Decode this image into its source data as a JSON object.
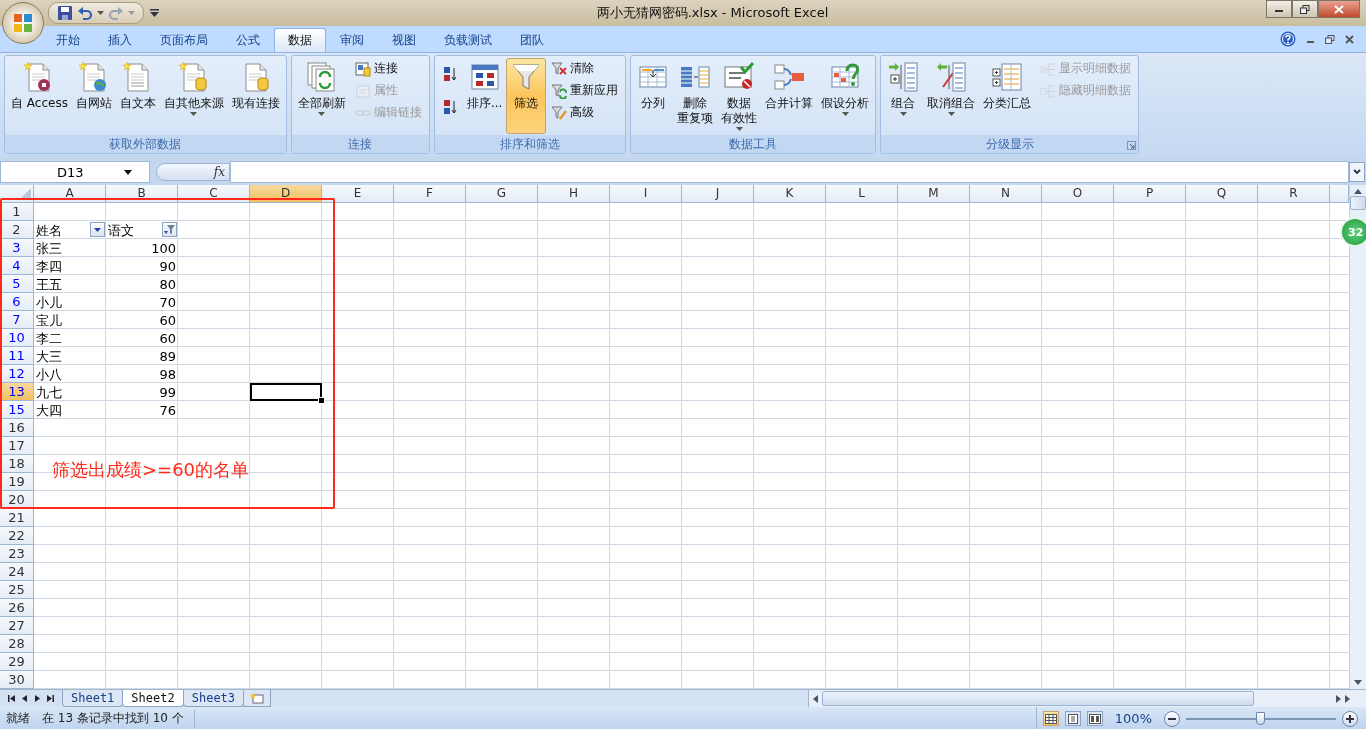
{
  "window": {
    "title": "两小无猜网密码.xlsx - Microsoft Excel"
  },
  "ribbon_tabs": [
    {
      "label": "开始",
      "selected": false
    },
    {
      "label": "插入",
      "selected": false
    },
    {
      "label": "页面布局",
      "selected": false
    },
    {
      "label": "公式",
      "selected": false
    },
    {
      "label": "数据",
      "selected": true
    },
    {
      "label": "审阅",
      "selected": false
    },
    {
      "label": "视图",
      "selected": false
    },
    {
      "label": "负载测试",
      "selected": false
    },
    {
      "label": "团队",
      "selected": false
    }
  ],
  "ribbon_groups": [
    {
      "title": "获取外部数据",
      "dialog_launcher": false,
      "items": [
        {
          "kind": "large",
          "label": "自 Access",
          "dropdown": false,
          "disabled": false,
          "selected": false
        },
        {
          "kind": "large",
          "label": "自网站",
          "dropdown": false,
          "disabled": false,
          "selected": false
        },
        {
          "kind": "large",
          "label": "自文本",
          "dropdown": false,
          "disabled": false,
          "selected": false
        },
        {
          "kind": "large",
          "label": "自其他来源",
          "dropdown": true,
          "disabled": false,
          "selected": false
        },
        {
          "kind": "large",
          "label": "现有连接",
          "dropdown": false,
          "disabled": false,
          "selected": false
        }
      ]
    },
    {
      "title": "连接",
      "dialog_launcher": false,
      "items": [
        {
          "kind": "large",
          "label": "全部刷新",
          "dropdown": true,
          "disabled": false,
          "selected": false
        },
        {
          "kind": "stack",
          "items": [
            {
              "label": "连接",
              "disabled": false
            },
            {
              "label": "属性",
              "disabled": true
            },
            {
              "label": "编辑链接",
              "disabled": true
            }
          ]
        }
      ]
    },
    {
      "title": "排序和筛选",
      "dialog_launcher": false,
      "items": [
        {
          "kind": "stack",
          "items": [
            {
              "disabled": false
            },
            {
              "disabled": false
            }
          ]
        },
        {
          "kind": "large",
          "label": "排序...",
          "dropdown": false,
          "disabled": false,
          "selected": false
        },
        {
          "kind": "large",
          "label": "筛选",
          "dropdown": false,
          "disabled": false,
          "selected": true
        },
        {
          "kind": "stack",
          "items": [
            {
              "label": "清除",
              "disabled": false
            },
            {
              "label": "重新应用",
              "disabled": false
            },
            {
              "label": "高级",
              "disabled": false
            }
          ]
        }
      ]
    },
    {
      "title": "数据工具",
      "dialog_launcher": false,
      "items": [
        {
          "kind": "large",
          "label": "分列",
          "dropdown": false,
          "disabled": false,
          "selected": false
        },
        {
          "kind": "large",
          "lines": [
            "删除",
            "重复项"
          ],
          "dropdown": false,
          "disabled": false,
          "selected": false
        },
        {
          "kind": "large",
          "lines": [
            "数据",
            "有效性"
          ],
          "dropdown": true,
          "disabled": false,
          "selected": false
        },
        {
          "kind": "large",
          "label": "合并计算",
          "dropdown": false,
          "disabled": false,
          "selected": false
        },
        {
          "kind": "large",
          "label": "假设分析",
          "dropdown": true,
          "disabled": false,
          "selected": false
        }
      ]
    },
    {
      "title": "分级显示",
      "dialog_launcher": true,
      "items": [
        {
          "kind": "large",
          "label": "组合",
          "dropdown": true,
          "disabled": false,
          "selected": false
        },
        {
          "kind": "large",
          "label": "取消组合",
          "dropdown": true,
          "disabled": false,
          "selected": false
        },
        {
          "kind": "large",
          "label": "分类汇总",
          "dropdown": false,
          "disabled": false,
          "selected": false
        },
        {
          "kind": "stack",
          "items": [
            {
              "label": "显示明细数据",
              "disabled": true
            },
            {
              "label": "隐藏明细数据",
              "disabled": true
            }
          ]
        }
      ]
    }
  ],
  "formula_bar": {
    "name_box": "D13",
    "function_button": "fx"
  },
  "columns": [
    {
      "label": "A",
      "selected": false
    },
    {
      "label": "B",
      "selected": false
    },
    {
      "label": "C",
      "selected": false
    },
    {
      "label": "D",
      "selected": true
    },
    {
      "label": "E",
      "selected": false
    },
    {
      "label": "F",
      "selected": false
    },
    {
      "label": "G",
      "selected": false
    },
    {
      "label": "H",
      "selected": false
    },
    {
      "label": "I",
      "selected": false
    },
    {
      "label": "J",
      "selected": false
    },
    {
      "label": "K",
      "selected": false
    },
    {
      "label": "L",
      "selected": false
    },
    {
      "label": "M",
      "selected": false
    },
    {
      "label": "N",
      "selected": false
    },
    {
      "label": "O",
      "selected": false
    },
    {
      "label": "P",
      "selected": false
    },
    {
      "label": "Q",
      "selected": false
    },
    {
      "label": "R",
      "selected": false
    }
  ],
  "rows": [
    {
      "number": "1",
      "filtered": false,
      "selected": false
    },
    {
      "number": "2",
      "filtered": false,
      "selected": false,
      "header": [
        {
          "label": "姓名",
          "filter_active": false
        },
        {
          "label": "语文",
          "filter_active": true
        }
      ]
    },
    {
      "number": "3",
      "filtered": true,
      "selected": false,
      "name": "张三",
      "score": "100"
    },
    {
      "number": "4",
      "filtered": true,
      "selected": false,
      "name": "李四",
      "score": "90"
    },
    {
      "number": "5",
      "filtered": true,
      "selected": false,
      "name": "王五",
      "score": "80"
    },
    {
      "number": "6",
      "filtered": true,
      "selected": false,
      "name": "小儿",
      "score": "70"
    },
    {
      "number": "7",
      "filtered": true,
      "selected": false,
      "name": "宝儿",
      "score": "60"
    },
    {
      "number": "10",
      "filtered": true,
      "selected": false,
      "name": "李二",
      "score": "60"
    },
    {
      "number": "11",
      "filtered": true,
      "selected": false,
      "name": "大三",
      "score": "89"
    },
    {
      "number": "12",
      "filtered": true,
      "selected": false,
      "name": "小八",
      "score": "98"
    },
    {
      "number": "13",
      "filtered": true,
      "selected": true,
      "name": "九七",
      "score": "99"
    },
    {
      "number": "15",
      "filtered": true,
      "selected": false,
      "name": "大四",
      "score": "76"
    },
    {
      "number": "16",
      "filtered": false,
      "selected": false
    },
    {
      "number": "17",
      "filtered": false,
      "selected": false
    },
    {
      "number": "18",
      "filtered": false,
      "selected": false
    },
    {
      "number": "19",
      "filtered": false,
      "selected": false
    },
    {
      "number": "20",
      "filtered": false,
      "selected": false
    },
    {
      "number": "21",
      "filtered": false,
      "selected": false
    },
    {
      "number": "22",
      "filtered": false,
      "selected": false
    },
    {
      "number": "23",
      "filtered": false,
      "selected": false
    },
    {
      "number": "24",
      "filtered": false,
      "selected": false
    },
    {
      "number": "25",
      "filtered": false,
      "selected": false
    },
    {
      "number": "26",
      "filtered": false,
      "selected": false
    },
    {
      "number": "27",
      "filtered": false,
      "selected": false
    },
    {
      "number": "28",
      "filtered": false,
      "selected": false
    },
    {
      "number": "29",
      "filtered": false,
      "selected": false
    },
    {
      "number": "30",
      "filtered": false,
      "selected": false
    }
  ],
  "annotation": {
    "text": "筛选出成绩>=60的名单"
  },
  "floating_badge": {
    "text": "32"
  },
  "sheet_tabs": [
    {
      "label": "Sheet1",
      "selected": false
    },
    {
      "label": "Sheet2",
      "selected": true
    },
    {
      "label": "Sheet3",
      "selected": false
    }
  ],
  "status_bar": {
    "state": "就绪",
    "message": "在 13 条记录中找到 10 个",
    "views": [
      {
        "selected": true
      },
      {
        "selected": false
      },
      {
        "selected": false
      }
    ],
    "zoom": {
      "label": "100%",
      "level": 0.5
    }
  }
}
